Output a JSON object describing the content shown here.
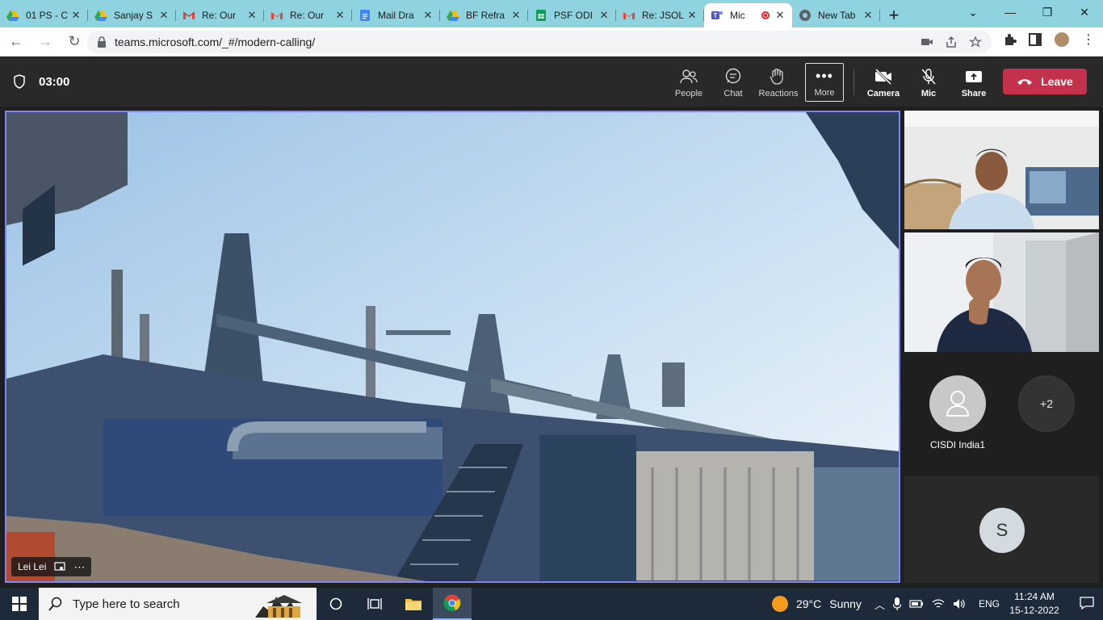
{
  "browser": {
    "tabs": [
      {
        "title": "01 PS - C",
        "icon": "google-drive-icon"
      },
      {
        "title": "Sanjay S",
        "icon": "google-drive-icon"
      },
      {
        "title": "Re: Our",
        "icon": "gmail-icon"
      },
      {
        "title": "Re: Our",
        "icon": "gmail-icon"
      },
      {
        "title": "Mail Dra",
        "icon": "google-docs-icon"
      },
      {
        "title": "BF Refra",
        "icon": "google-drive-icon"
      },
      {
        "title": "PSF ODI",
        "icon": "google-sheets-icon"
      },
      {
        "title": "Re: JSOL",
        "icon": "gmail-icon"
      },
      {
        "title": "Mic",
        "icon": "teams-icon",
        "active": true
      },
      {
        "title": "New Tab",
        "icon": "chrome-icon"
      }
    ],
    "new_tab_symbol": "+",
    "url": "teams.microsoft.com/_#/modern-calling/"
  },
  "meeting": {
    "timer": "03:00",
    "tools": {
      "people": "People",
      "chat": "Chat",
      "reactions": "Reactions",
      "more": "More",
      "camera": "Camera",
      "mic": "Mic",
      "share": "Share"
    },
    "leave_label": "Leave",
    "leave_color": "#c4314b",
    "accent_color": "#7f85f5",
    "presenter_name": "Lei Lei",
    "participants": {
      "avatar_name": "CISDI India1",
      "more_count": "+2",
      "initial": "S"
    }
  },
  "taskbar": {
    "search_placeholder": "Type here to search",
    "weather_temp": "29°C",
    "weather_desc": "Sunny",
    "language": "ENG",
    "time": "11:24 AM",
    "date": "15-12-2022"
  }
}
